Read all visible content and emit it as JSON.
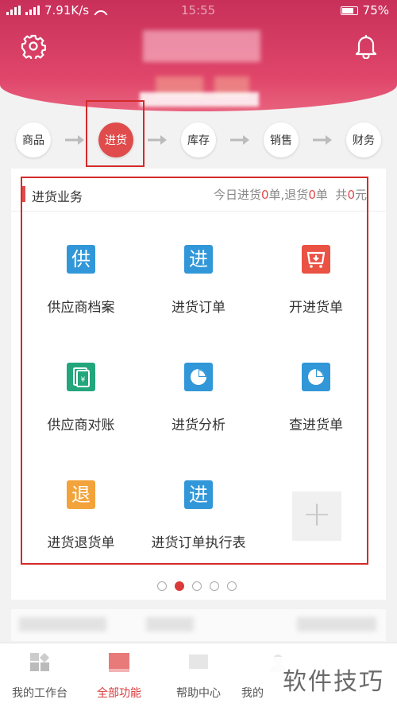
{
  "status_bar": {
    "network": "7.91K/s",
    "time": "15:55",
    "battery": "75%"
  },
  "flow": {
    "steps": [
      {
        "label": "商品"
      },
      {
        "label": "进货"
      },
      {
        "label": "库存"
      },
      {
        "label": "销售"
      },
      {
        "label": "财务"
      }
    ],
    "active_index": 1
  },
  "card": {
    "title": "进货业务",
    "stats": {
      "prefix1": "今日进货",
      "purchase_count": "0",
      "unit1": "单",
      "sep": ",退货",
      "return_count": "0",
      "unit2": "单",
      "total_label": "共",
      "total_amount": "0",
      "currency": "元"
    },
    "items": [
      {
        "label": "供应商档案",
        "icon_text": "供",
        "icon": "supplier-icon",
        "color": "#3197d8"
      },
      {
        "label": "进货订单",
        "icon_text": "进",
        "icon": "purchase-order-icon",
        "color": "#3197d8"
      },
      {
        "label": "开进货单",
        "icon_text": "",
        "icon": "cart-icon",
        "color": "#ea5244"
      },
      {
        "label": "供应商对账",
        "icon_text": "",
        "icon": "reconcile-icon",
        "color": "#23a67c"
      },
      {
        "label": "进货分析",
        "icon_text": "",
        "icon": "pie-chart-icon",
        "color": "#3197d8"
      },
      {
        "label": "查进货单",
        "icon_text": "",
        "icon": "pie-chart-icon",
        "color": "#3197d8"
      },
      {
        "label": "进货退货单",
        "icon_text": "退",
        "icon": "return-icon",
        "color": "#f3a33b"
      },
      {
        "label": "进货订单执行表",
        "icon_text": "进",
        "icon": "order-execution-icon",
        "color": "#3197d8"
      }
    ],
    "add_symbol": "+"
  },
  "pager": {
    "page_count": 5,
    "current": 2
  },
  "tabbar": {
    "tabs": [
      {
        "label": "我的工作台",
        "icon": "workbench-icon"
      },
      {
        "label": "全部功能",
        "icon": "all-functions-icon"
      },
      {
        "label": "帮助中心",
        "icon": "help-icon"
      },
      {
        "label": "我的",
        "icon": "profile-icon"
      }
    ],
    "active_index": 1
  },
  "watermark": "软件技巧"
}
